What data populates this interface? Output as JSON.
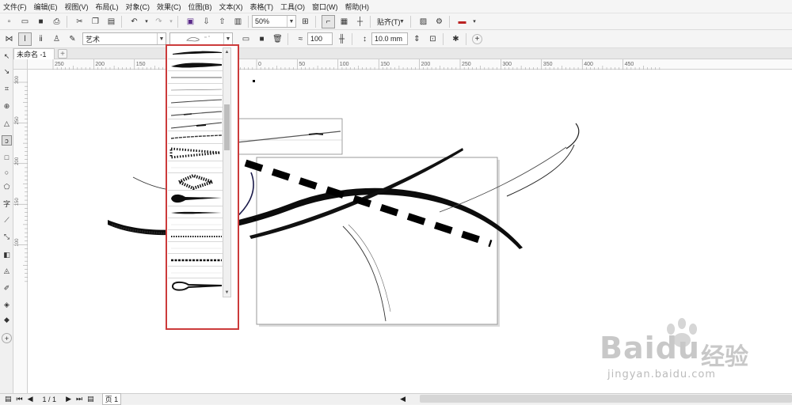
{
  "menu": [
    "文件(F)",
    "编辑(E)",
    "视图(V)",
    "布局(L)",
    "对象(C)",
    "效果(C)",
    "位图(B)",
    "文本(X)",
    "表格(T)",
    "工具(O)",
    "窗口(W)",
    "帮助(H)"
  ],
  "toolbar1": {
    "zoom_value": "50%",
    "snap_label": "贴齐(T)"
  },
  "toolbar2": {
    "preset_category": "艺术",
    "smoothing_value": "100",
    "width_value": "10.0 mm"
  },
  "document_tab": "未命名 -1",
  "hruler_ticks": [
    "250",
    "200",
    "150",
    "100",
    "50",
    "0",
    "50",
    "100",
    "150",
    "200",
    "250",
    "300",
    "350",
    "400",
    "450"
  ],
  "vruler_ticks": [
    "300",
    "250",
    "200",
    "150",
    "100"
  ],
  "status": {
    "page_counter": "1 / 1",
    "page_tab": "页 1"
  },
  "watermark": {
    "brand": "Baidu",
    "cn": "经验",
    "url": "jingyan.baidu.com"
  },
  "colors": {
    "highlight_border": "#cc3b3b",
    "ui_background": "#f3f3f3",
    "stroke": "#000000"
  }
}
